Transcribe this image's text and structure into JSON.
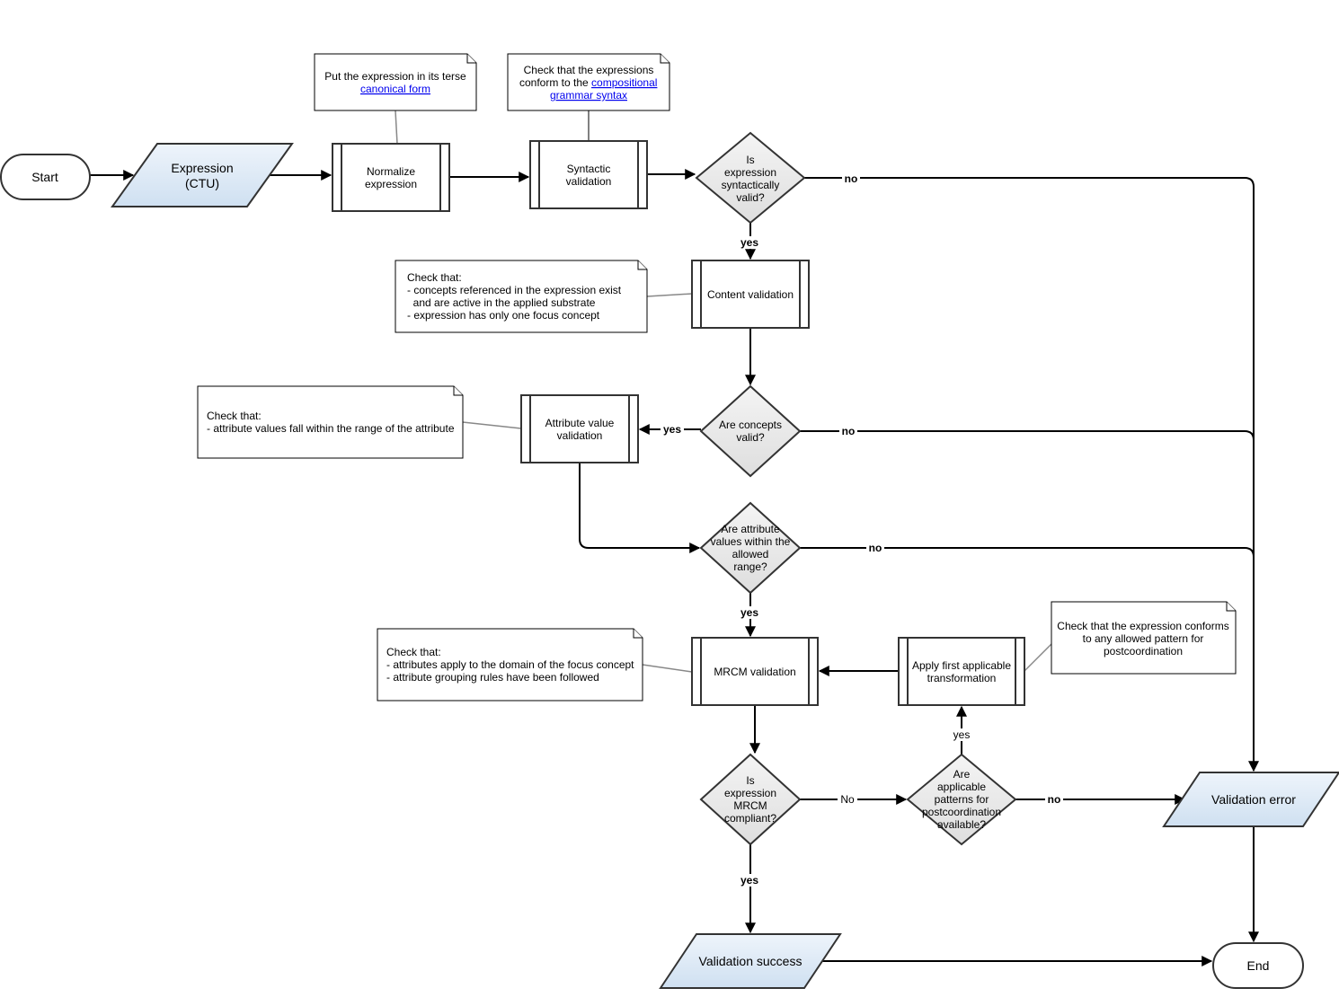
{
  "colors": {
    "io_fill_top": "#eef4fb",
    "io_fill_bottom": "#cfe0f1",
    "decision_fill_top": "#f4f4f4",
    "decision_fill_bottom": "#dedede",
    "link": "#0000ee"
  },
  "nodes": {
    "start": "Start",
    "expression": [
      "Expression",
      "(CTU)"
    ],
    "normalize": [
      "Normalize",
      "expression"
    ],
    "syntactic": [
      "Syntactic",
      "validation"
    ],
    "syntax_decision": [
      "Is",
      "expression",
      "syntactically",
      "valid?"
    ],
    "content": "Content validation",
    "concepts_decision": [
      "Are concepts",
      "valid?"
    ],
    "attribute": [
      "Attribute value",
      "validation"
    ],
    "range_decision": [
      "Are attribute",
      "values within the",
      "allowed",
      "range?"
    ],
    "mrcm": "MRCM validation",
    "apply": [
      "Apply first applicable",
      "transformation"
    ],
    "mrcm_decision": [
      "Is",
      "expression",
      "MRCM",
      "compliant?"
    ],
    "patterns_decision": [
      "Are",
      "applicable",
      "patterns for",
      "postcoordination",
      "available?"
    ],
    "error": "Validation error",
    "success": "Validation success",
    "end": "End"
  },
  "notes": {
    "normalize": {
      "text": "Put the expression in its terse",
      "link": "canonical form"
    },
    "syntactic": {
      "line1": "Check that the expressions",
      "line2": "conform to the ",
      "link1": "compositional",
      "link2": "grammar syntax"
    },
    "content": [
      "Check that:",
      "- concepts referenced in the expression exist",
      "  and are active in the applied substrate",
      "- expression has only one focus concept"
    ],
    "attribute": [
      "Check that:",
      "- attribute values fall within the range of the attribute"
    ],
    "mrcm": [
      "Check that:",
      "- attributes apply to the domain of the focus concept",
      "- attribute grouping rules have been followed"
    ],
    "pattern": [
      "Check that the expression conforms",
      "to any allowed pattern for",
      "postcoordination"
    ]
  },
  "edge_labels": {
    "no": "no",
    "yes": "yes",
    "No": "No"
  }
}
